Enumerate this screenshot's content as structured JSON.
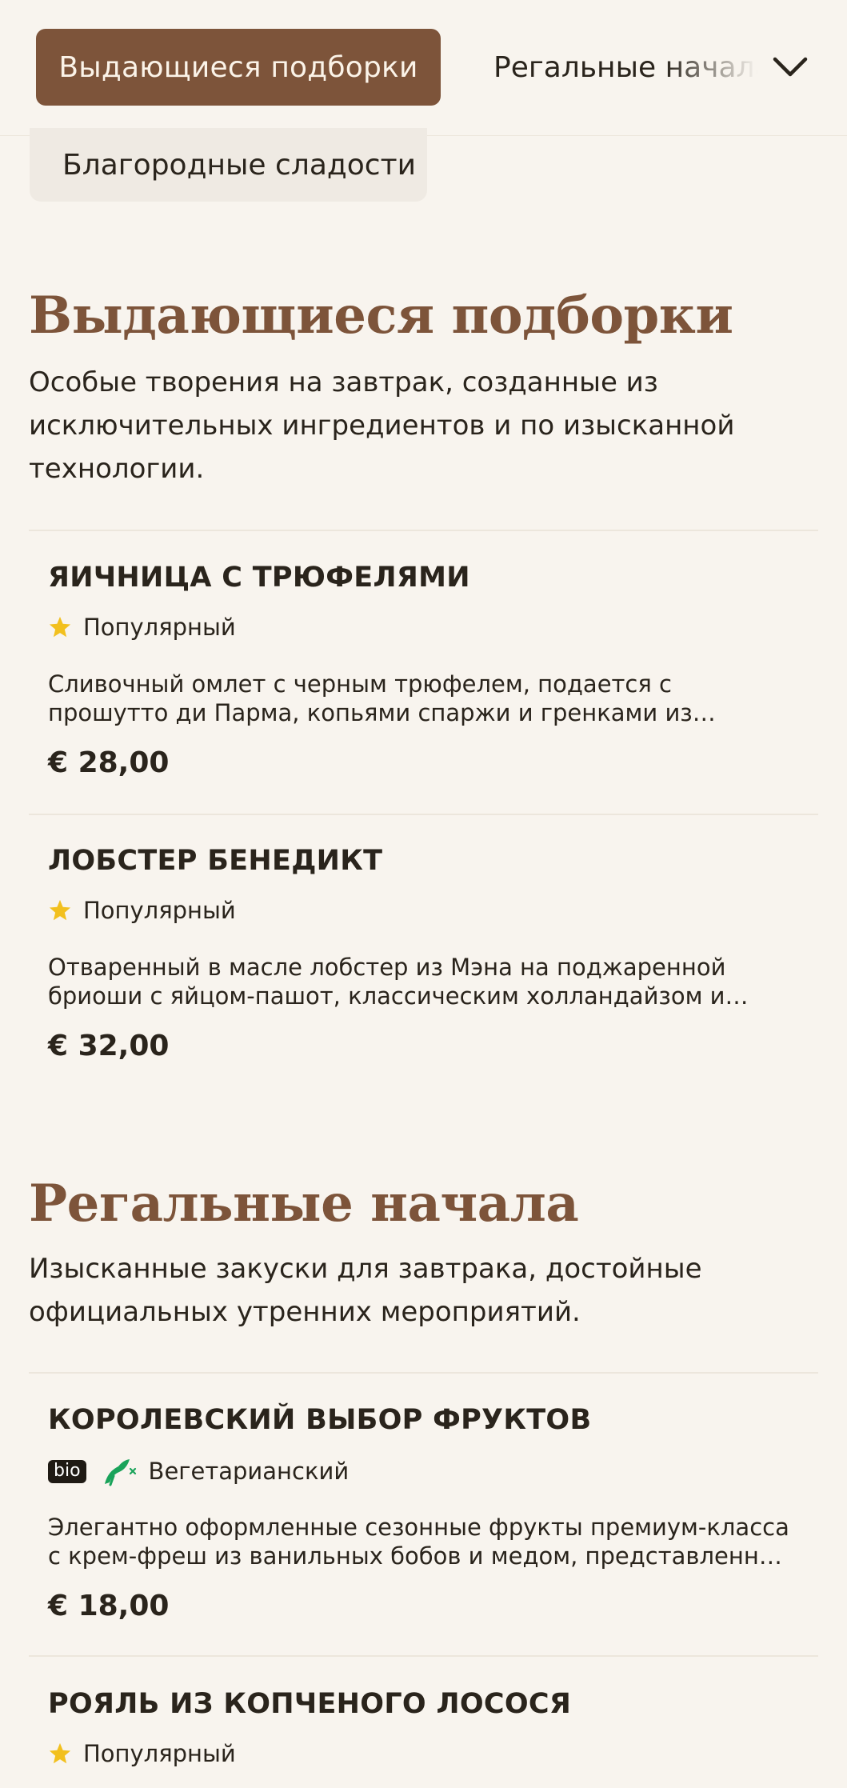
{
  "nav": {
    "active_tab": "Выдающиеся подборки",
    "next_tab": "Регальные начала",
    "second_row_tab": "Благородные сладости",
    "expand_icon": "chevron-down-icon"
  },
  "sections": [
    {
      "title": "Выдающиеся подборки",
      "description": "Особые творения на завтрак, созданные из исключительных ингредиентов и по изысканной технологии.",
      "items": [
        {
          "name": "ЯИЧНИЦА С ТРЮФЕЛЯМИ",
          "tag": "Популярный",
          "description": "Сливочный омлет с черным трюфелем, подается с прошутто ди Парма, копьями спаржи и гренками из бриоши.",
          "price": "€ 28,00"
        },
        {
          "name": "ЛОБСТЕР БЕНЕДИКТ",
          "tag": "Популярный",
          "description": "Отваренный в масле лобстер из Мэна на поджаренной бриоши с яйцом-пашот, классическим холландайзом и икрой.",
          "price": "€ 32,00"
        }
      ]
    },
    {
      "title": "Регальные начала",
      "description": "Изысканные закуски для завтрака, достойные официальных утренних мероприятий.",
      "items": [
        {
          "name": "КОРОЛЕВСКИЙ ВЫБОР ФРУКТОВ",
          "badge": "bio",
          "tag": "Вегетарианский",
          "description": "Элегантно оформленные сезонные фрукты премиум-класса с крем-фреш из ванильных бобов и медом, представленные на серебряном блюде.",
          "price": "€ 18,00"
        },
        {
          "name": "РОЯЛЬ ИЗ КОПЧЕНОГО ЛОСОСЯ",
          "tag": "Популярный"
        }
      ]
    }
  ],
  "colors": {
    "accent": "#7d543a",
    "background": "#f8f4ee",
    "star": "#f2c01e",
    "vegetarian": "#1aa35a"
  }
}
